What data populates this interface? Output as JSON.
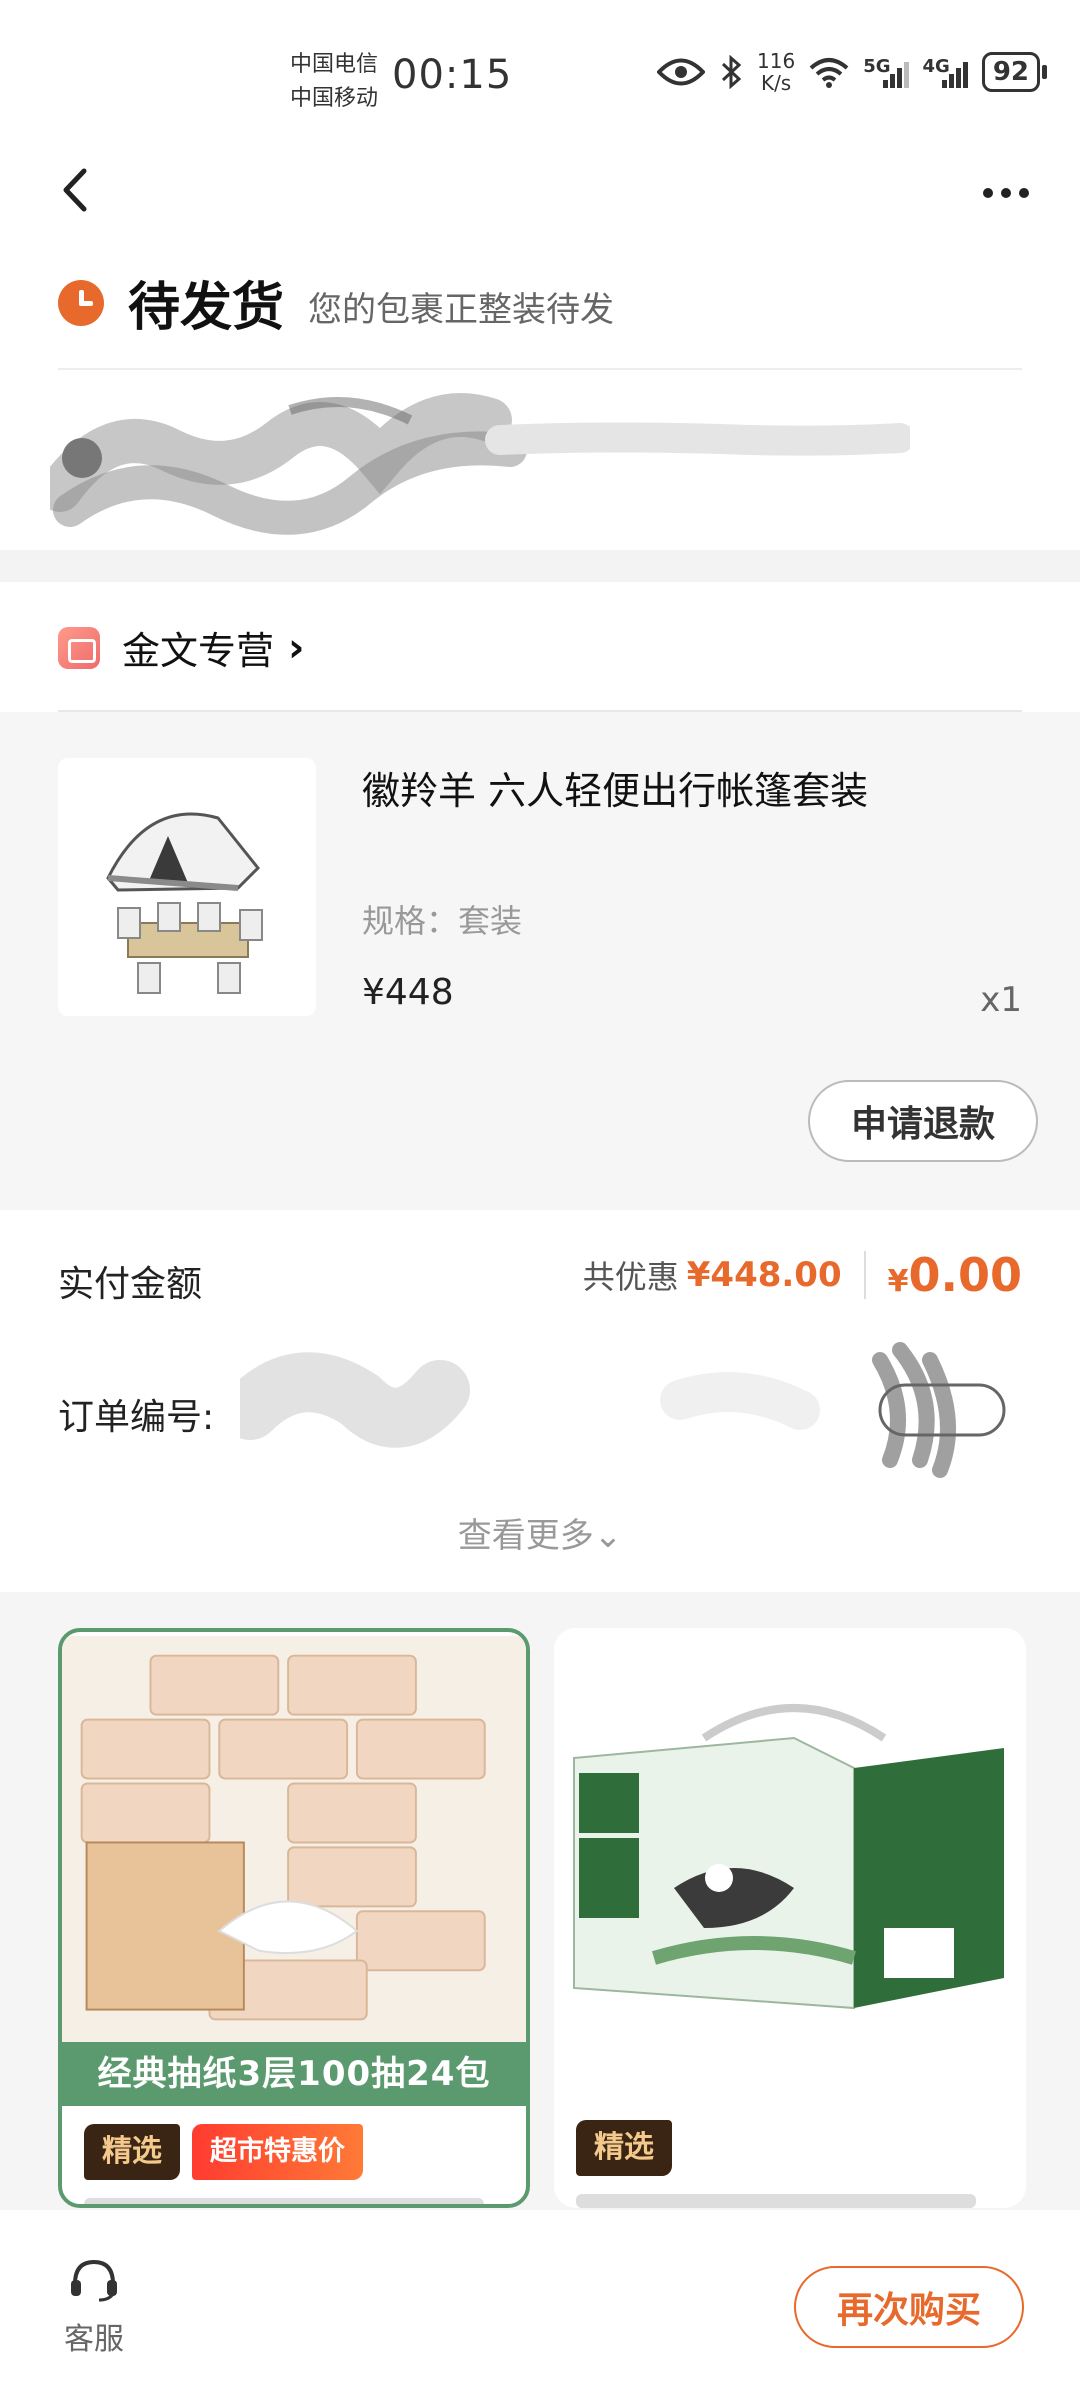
{
  "status_bar": {
    "carrier_1": "中国电信",
    "carrier_2": "中国移动",
    "time": "00:15",
    "net_speed_value": "116",
    "net_speed_unit": "K/s",
    "sig_1": "5G",
    "sig_2": "4G",
    "battery": "92"
  },
  "header": {
    "back_icon": "chevron-left-icon",
    "more_icon": "more-dots-icon",
    "status_title": "待发货",
    "status_sub": "您的包裹正整装待发"
  },
  "shop": {
    "name": "金文专营",
    "arrow": "›"
  },
  "product": {
    "title": "徽羚羊 六人轻便出行帐篷套装",
    "spec": "规格：套装",
    "price": "¥448",
    "qty": "x1",
    "refund_label": "申请退款"
  },
  "payment": {
    "label": "实付金额",
    "discount_label": "共优惠",
    "discount_value": "¥448.00",
    "paid_currency": "¥",
    "paid_value": "0.00"
  },
  "order": {
    "number_label": "订单编号:",
    "view_more": "查看更多⌄"
  },
  "recommendations": [
    {
      "banner": "经典抽纸3层100抽24包",
      "tags": [
        "精选",
        "超市特惠价"
      ]
    },
    {
      "tags": [
        "精选"
      ]
    }
  ],
  "bottom": {
    "service_label": "客服",
    "rebuy_label": "再次购买"
  },
  "colors": {
    "accent": "#e8692c",
    "banner_green": "#5a9a6e",
    "tag_dark": "#3a2414"
  }
}
